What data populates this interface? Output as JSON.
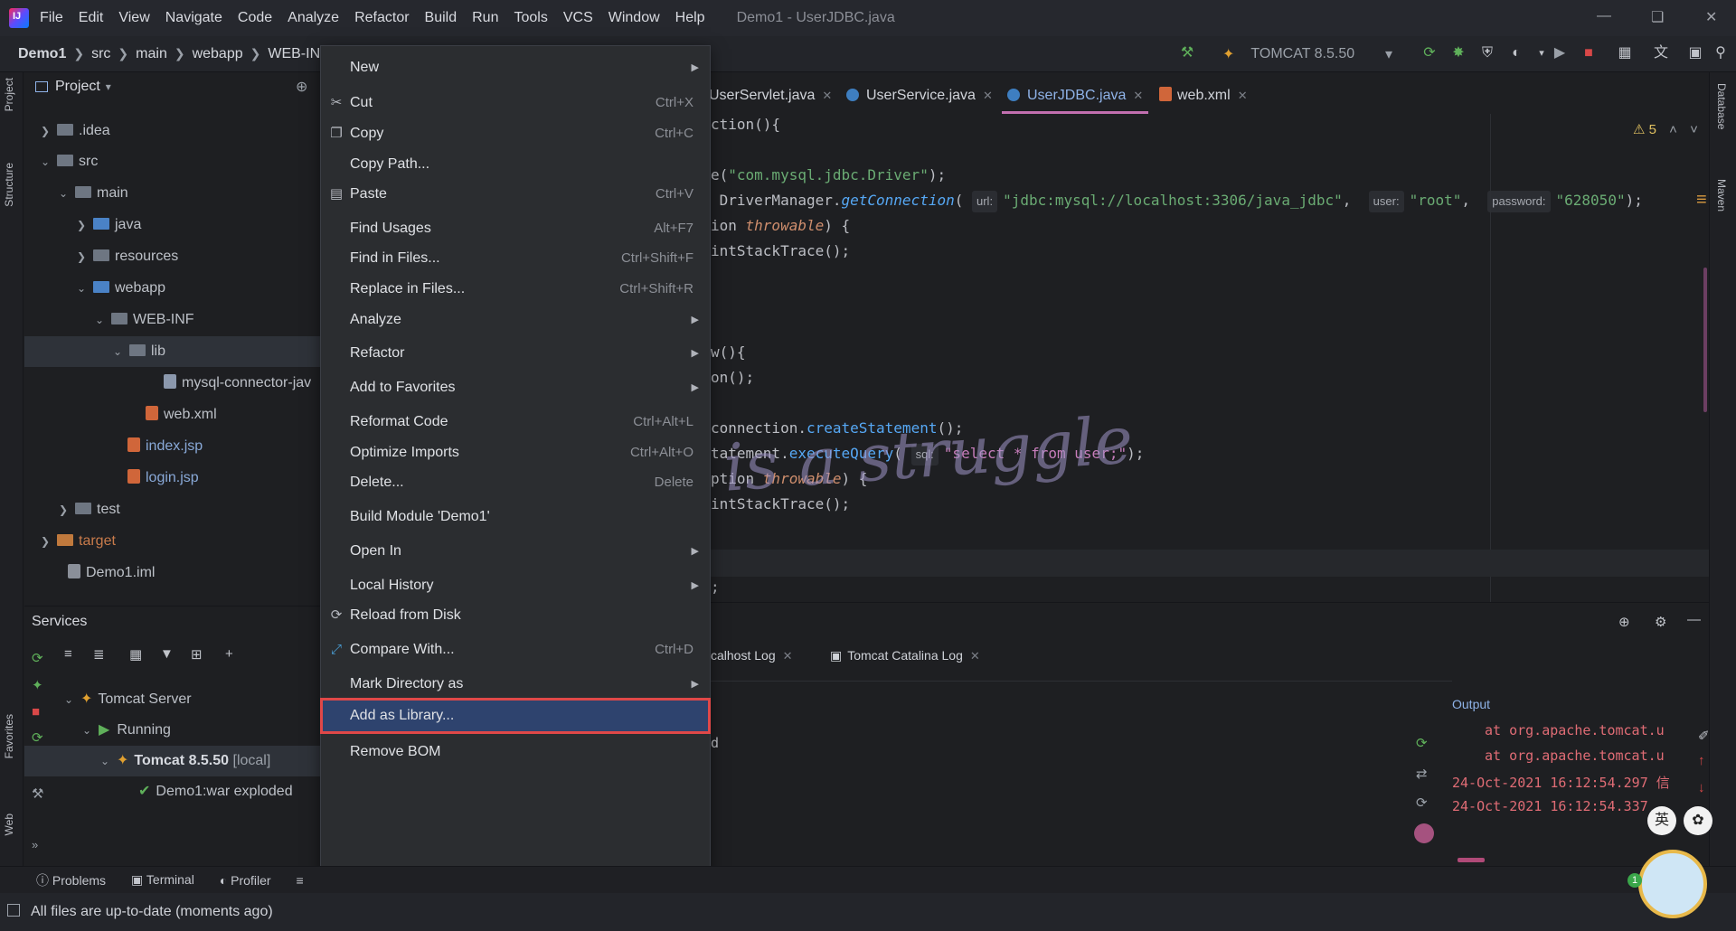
{
  "menubar": {
    "items": [
      "File",
      "Edit",
      "View",
      "Navigate",
      "Code",
      "Analyze",
      "Refactor",
      "Build",
      "Run",
      "Tools",
      "VCS",
      "Window",
      "Help"
    ],
    "window_title": "Demo1 - UserJDBC.java"
  },
  "breadcrumb": [
    "Demo1",
    "src",
    "main",
    "webapp",
    "WEB-INF"
  ],
  "run_config": "TOMCAT 8.5.50",
  "project_panel": {
    "title": "Project",
    "tree": [
      ".idea",
      "src",
      "main",
      "java",
      "resources",
      "webapp",
      "WEB-INF",
      "lib",
      "mysql-connector-jav",
      "web.xml",
      "index.jsp",
      "login.jsp",
      "test",
      "target",
      "Demo1.iml"
    ]
  },
  "services": {
    "title": "Services",
    "tree": [
      "Tomcat Server",
      "Running",
      "Tomcat 8.5.50",
      "[local]",
      "Demo1:war exploded"
    ]
  },
  "left_strip": [
    "Project",
    "Structure",
    "Favorites",
    "Web"
  ],
  "right_strip": [
    "Database",
    "Maven"
  ],
  "editor_tabs": [
    {
      "label": "UserServlet.java"
    },
    {
      "label": "UserService.java"
    },
    {
      "label": "UserJDBC.java"
    },
    {
      "label": "web.xml"
    }
  ],
  "editor": {
    "warning_count": "5",
    "lines": {
      "l1": "ction(){",
      "l2_a": "e(",
      "l2_s": "\"com.mysql.jdbc.Driver\"",
      "l2_b": ");",
      "l3_a": " DriverManager.",
      "l3_f": "getConnection",
      "l3_b": "( ",
      "hint_url": "url:",
      "l3_s1": "\"jdbc:mysql://localhost:3306/java_jdbc\"",
      "l3_c": ",  ",
      "hint_user": "user:",
      "l3_s2": "\"root\"",
      "l3_d": ",  ",
      "hint_password": "password:",
      "l3_s3": "\"628050\"",
      "l3_e": ");",
      "l4_a": "ion ",
      "l4_k": "throwable",
      "l4_b": ") {",
      "l5": "intStackTrace();",
      "l6": "w(){",
      "l7": "on();",
      "l8_a": "connection.",
      "l8_f": "createStatement",
      "l8_b": "();",
      "l9_a": "tatement.",
      "l9_f": "executeQuery",
      "l9_b": "( ",
      "hint_sql": "sql:",
      "l9_s": "\"select * from user;\"",
      "l9_c": ");",
      "l10_a": "ption ",
      "l10_k": "throwable",
      "l10_b": ") {",
      "l11": "intStackTrace();",
      "l12": ";"
    }
  },
  "console": {
    "tabs": [
      "calhost Log",
      "Tomcat Catalina Log"
    ],
    "status_text": "d",
    "output_label": "Output",
    "output_lines": [
      "at org.apache.tomcat.u",
      "at org.apache.tomcat.u",
      "24-Oct-2021 16:12:54.297 信",
      "24-Oct-2021 16:12:54.337"
    ]
  },
  "context_menu": {
    "items": [
      {
        "label": "New",
        "shortcut": "",
        "submenu": true
      },
      {
        "label": "Cut",
        "shortcut": "Ctrl+X",
        "icon": "scissors-icon"
      },
      {
        "label": "Copy",
        "shortcut": "Ctrl+C",
        "icon": "copy-icon"
      },
      {
        "label": "Copy Path...",
        "shortcut": ""
      },
      {
        "label": "Paste",
        "shortcut": "Ctrl+V",
        "icon": "paste-icon"
      },
      {
        "label": "Find Usages",
        "shortcut": "Alt+F7"
      },
      {
        "label": "Find in Files...",
        "shortcut": "Ctrl+Shift+F"
      },
      {
        "label": "Replace in Files...",
        "shortcut": "Ctrl+Shift+R"
      },
      {
        "label": "Analyze",
        "shortcut": "",
        "submenu": true
      },
      {
        "label": "Refactor",
        "shortcut": "",
        "submenu": true
      },
      {
        "label": "Add to Favorites",
        "shortcut": "",
        "submenu": true
      },
      {
        "label": "Reformat Code",
        "shortcut": "Ctrl+Alt+L"
      },
      {
        "label": "Optimize Imports",
        "shortcut": "Ctrl+Alt+O"
      },
      {
        "label": "Delete...",
        "shortcut": "Delete"
      },
      {
        "label": "Build Module 'Demo1'",
        "shortcut": ""
      },
      {
        "label": "Open In",
        "shortcut": "",
        "submenu": true
      },
      {
        "label": "Local History",
        "shortcut": "",
        "submenu": true
      },
      {
        "label": "Reload from Disk",
        "shortcut": "",
        "icon": "reload-icon"
      },
      {
        "label": "Compare With...",
        "shortcut": "Ctrl+D",
        "icon": "compare-icon"
      },
      {
        "label": "Mark Directory as",
        "shortcut": "",
        "submenu": true
      },
      {
        "label": "Add as Library...",
        "shortcut": "",
        "highlighted": true
      },
      {
        "label": "Remove BOM",
        "shortcut": ""
      }
    ]
  },
  "bottom_tools": [
    "Problems",
    "Terminal",
    "Profiler"
  ],
  "status_bar": "All files are up-to-date (moments ago)",
  "watermark": "is a struggle",
  "ime_badge": "英"
}
